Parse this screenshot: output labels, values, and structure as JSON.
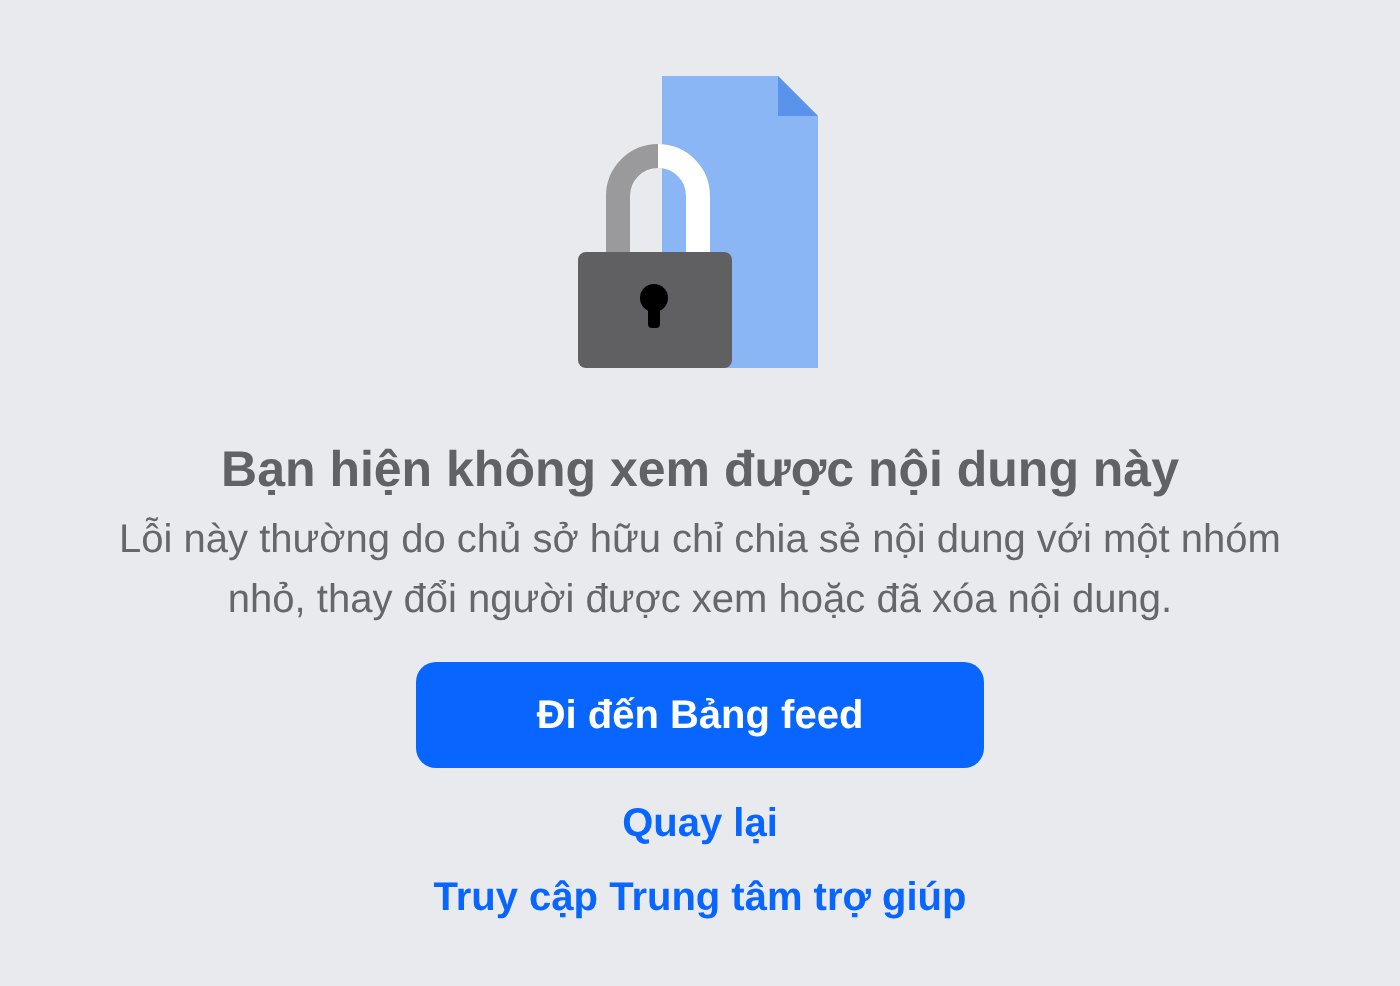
{
  "title": "Bạn hiện không xem được nội dung này",
  "message": "Lỗi này thường do chủ sở hữu chỉ chia sẻ nội dung với một nhóm nhỏ, thay đổi người được xem hoặc đã xóa nội dung.",
  "primary_button": "Đi đến Bảng feed",
  "links": [
    "Quay lại",
    "Truy cập Trung tâm trợ giúp"
  ]
}
